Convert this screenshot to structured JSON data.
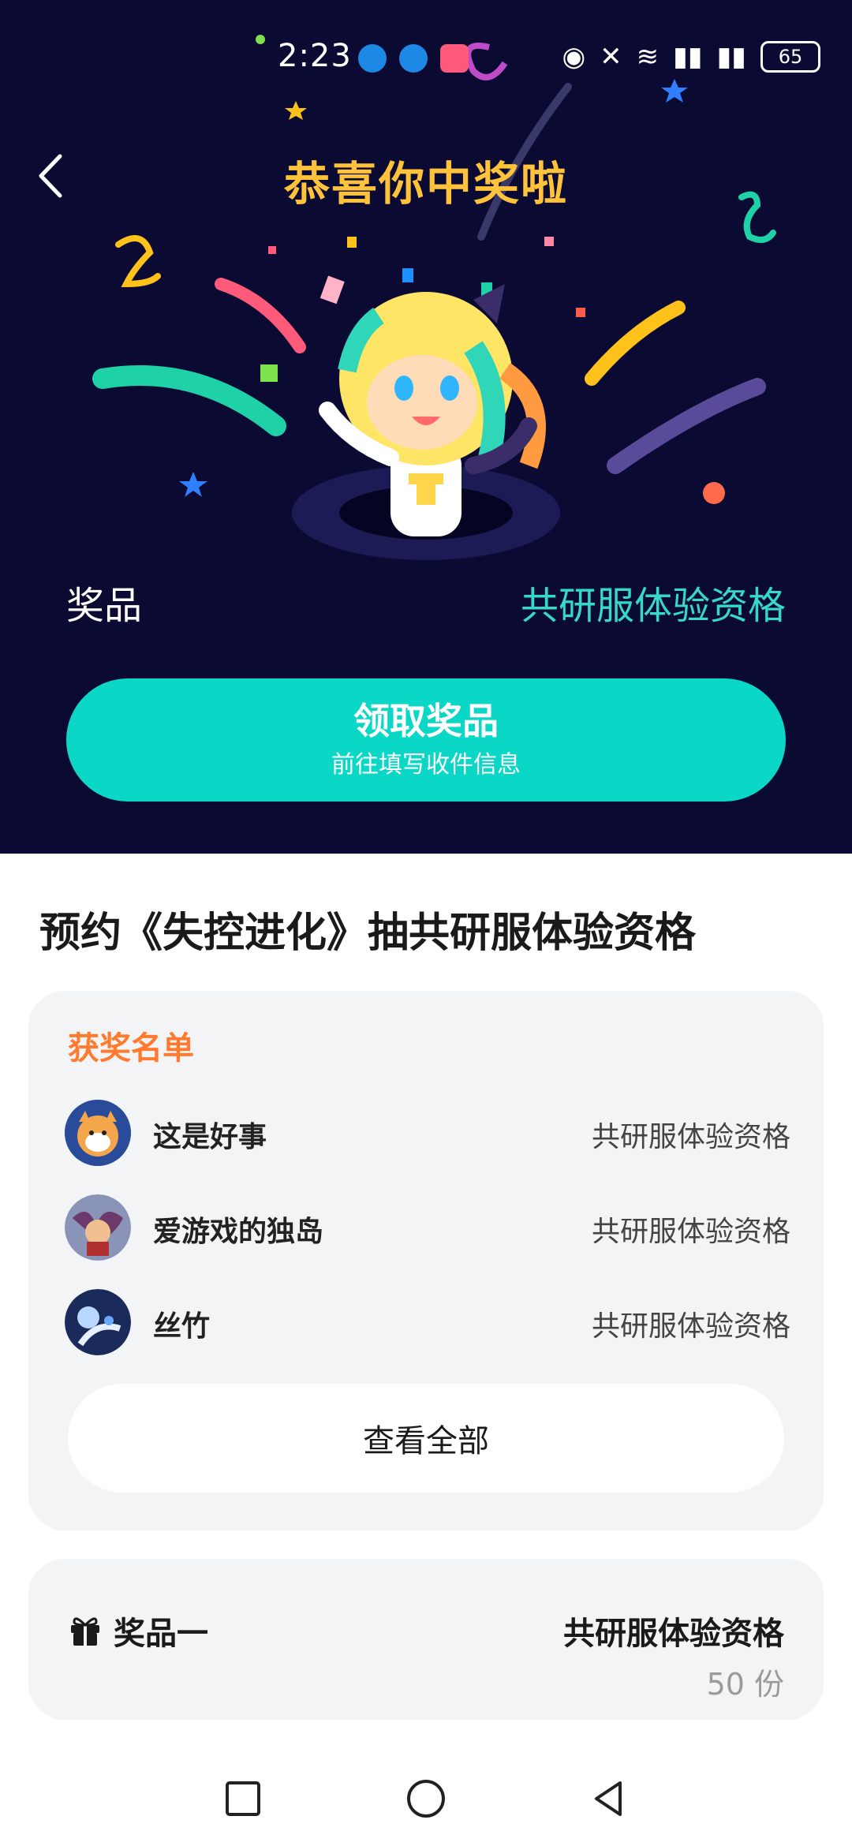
{
  "status_bar": {
    "time": "2:23",
    "battery": "65"
  },
  "hero": {
    "title": "恭喜你中奖啦",
    "prize_label": "奖品",
    "prize_value": "共研服体验资格"
  },
  "claim_button": {
    "title": "领取奖品",
    "subtitle": "前往填写收件信息"
  },
  "event": {
    "title": "预约《失控进化》抽共研服体验资格"
  },
  "winners": {
    "heading": "获奖名单",
    "list": [
      {
        "name": "这是好事",
        "prize": "共研服体验资格"
      },
      {
        "name": "爱游戏的独岛",
        "prize": "共研服体验资格"
      },
      {
        "name": "丝竹",
        "prize": "共研服体验资格"
      }
    ],
    "view_all": "查看全部"
  },
  "prize_card": {
    "label": "奖品一",
    "name": "共研服体验资格",
    "quantity": "50 份"
  },
  "colors": {
    "hero_bg": "#0b0a33",
    "accent_teal": "#0bd7c7",
    "title_yellow": "#ffc33b",
    "winners_heading": "#ff7a2e"
  },
  "icons": [
    "back-icon",
    "gift-icon",
    "nav-square-icon",
    "nav-home-icon",
    "nav-back-icon"
  ]
}
